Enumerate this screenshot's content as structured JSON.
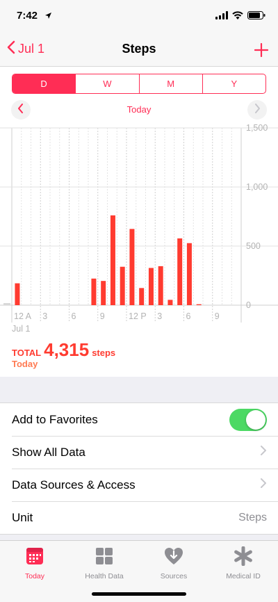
{
  "status": {
    "time": "7:42"
  },
  "nav": {
    "back_label": "Jul 1",
    "title": "Steps"
  },
  "segments": [
    {
      "label": "D",
      "active": true
    },
    {
      "label": "W",
      "active": false
    },
    {
      "label": "M",
      "active": false
    },
    {
      "label": "Y",
      "active": false
    }
  ],
  "date_label": "Today",
  "chart_data": {
    "type": "bar",
    "y_ticks": [
      "1,500",
      "1,000",
      "500",
      "0"
    ],
    "ylim": [
      0,
      1500
    ],
    "x_tick_labels": [
      "12 A",
      "3",
      "6",
      "9",
      "12 P",
      "3",
      "6",
      "9"
    ],
    "x_sub_label": "Jul 1",
    "x_unit": "hour",
    "bars": [
      {
        "hour": 0.25,
        "value": 185
      },
      {
        "hour": 8.25,
        "value": 225
      },
      {
        "hour": 9.25,
        "value": 205
      },
      {
        "hour": 10.25,
        "value": 760
      },
      {
        "hour": 11.25,
        "value": 325
      },
      {
        "hour": 12.25,
        "value": 645
      },
      {
        "hour": 13.25,
        "value": 145
      },
      {
        "hour": 14.25,
        "value": 315
      },
      {
        "hour": 15.25,
        "value": 330
      },
      {
        "hour": 16.25,
        "value": 45
      },
      {
        "hour": 17.25,
        "value": 565
      },
      {
        "hour": 18.25,
        "value": 525
      },
      {
        "hour": 19.25,
        "value": 8
      }
    ],
    "bar_color": "#ff3b30"
  },
  "total": {
    "label": "TOTAL",
    "value": "4,315",
    "unit": "steps",
    "sub": "Today"
  },
  "settings": {
    "favorites": "Add to Favorites",
    "show_all": "Show All Data",
    "sources": "Data Sources & Access",
    "unit_label": "Unit",
    "unit_value": "Steps"
  },
  "tabs": [
    {
      "label": "Today",
      "icon": "calendar-icon",
      "active": true
    },
    {
      "label": "Health Data",
      "icon": "grid-icon",
      "active": false
    },
    {
      "label": "Sources",
      "icon": "heart-download-icon",
      "active": false
    },
    {
      "label": "Medical ID",
      "icon": "asterisk-icon",
      "active": false
    }
  ],
  "colors": {
    "accent": "#ff2d55",
    "toggle_on": "#4cd964",
    "bar": "#ff3b30"
  }
}
